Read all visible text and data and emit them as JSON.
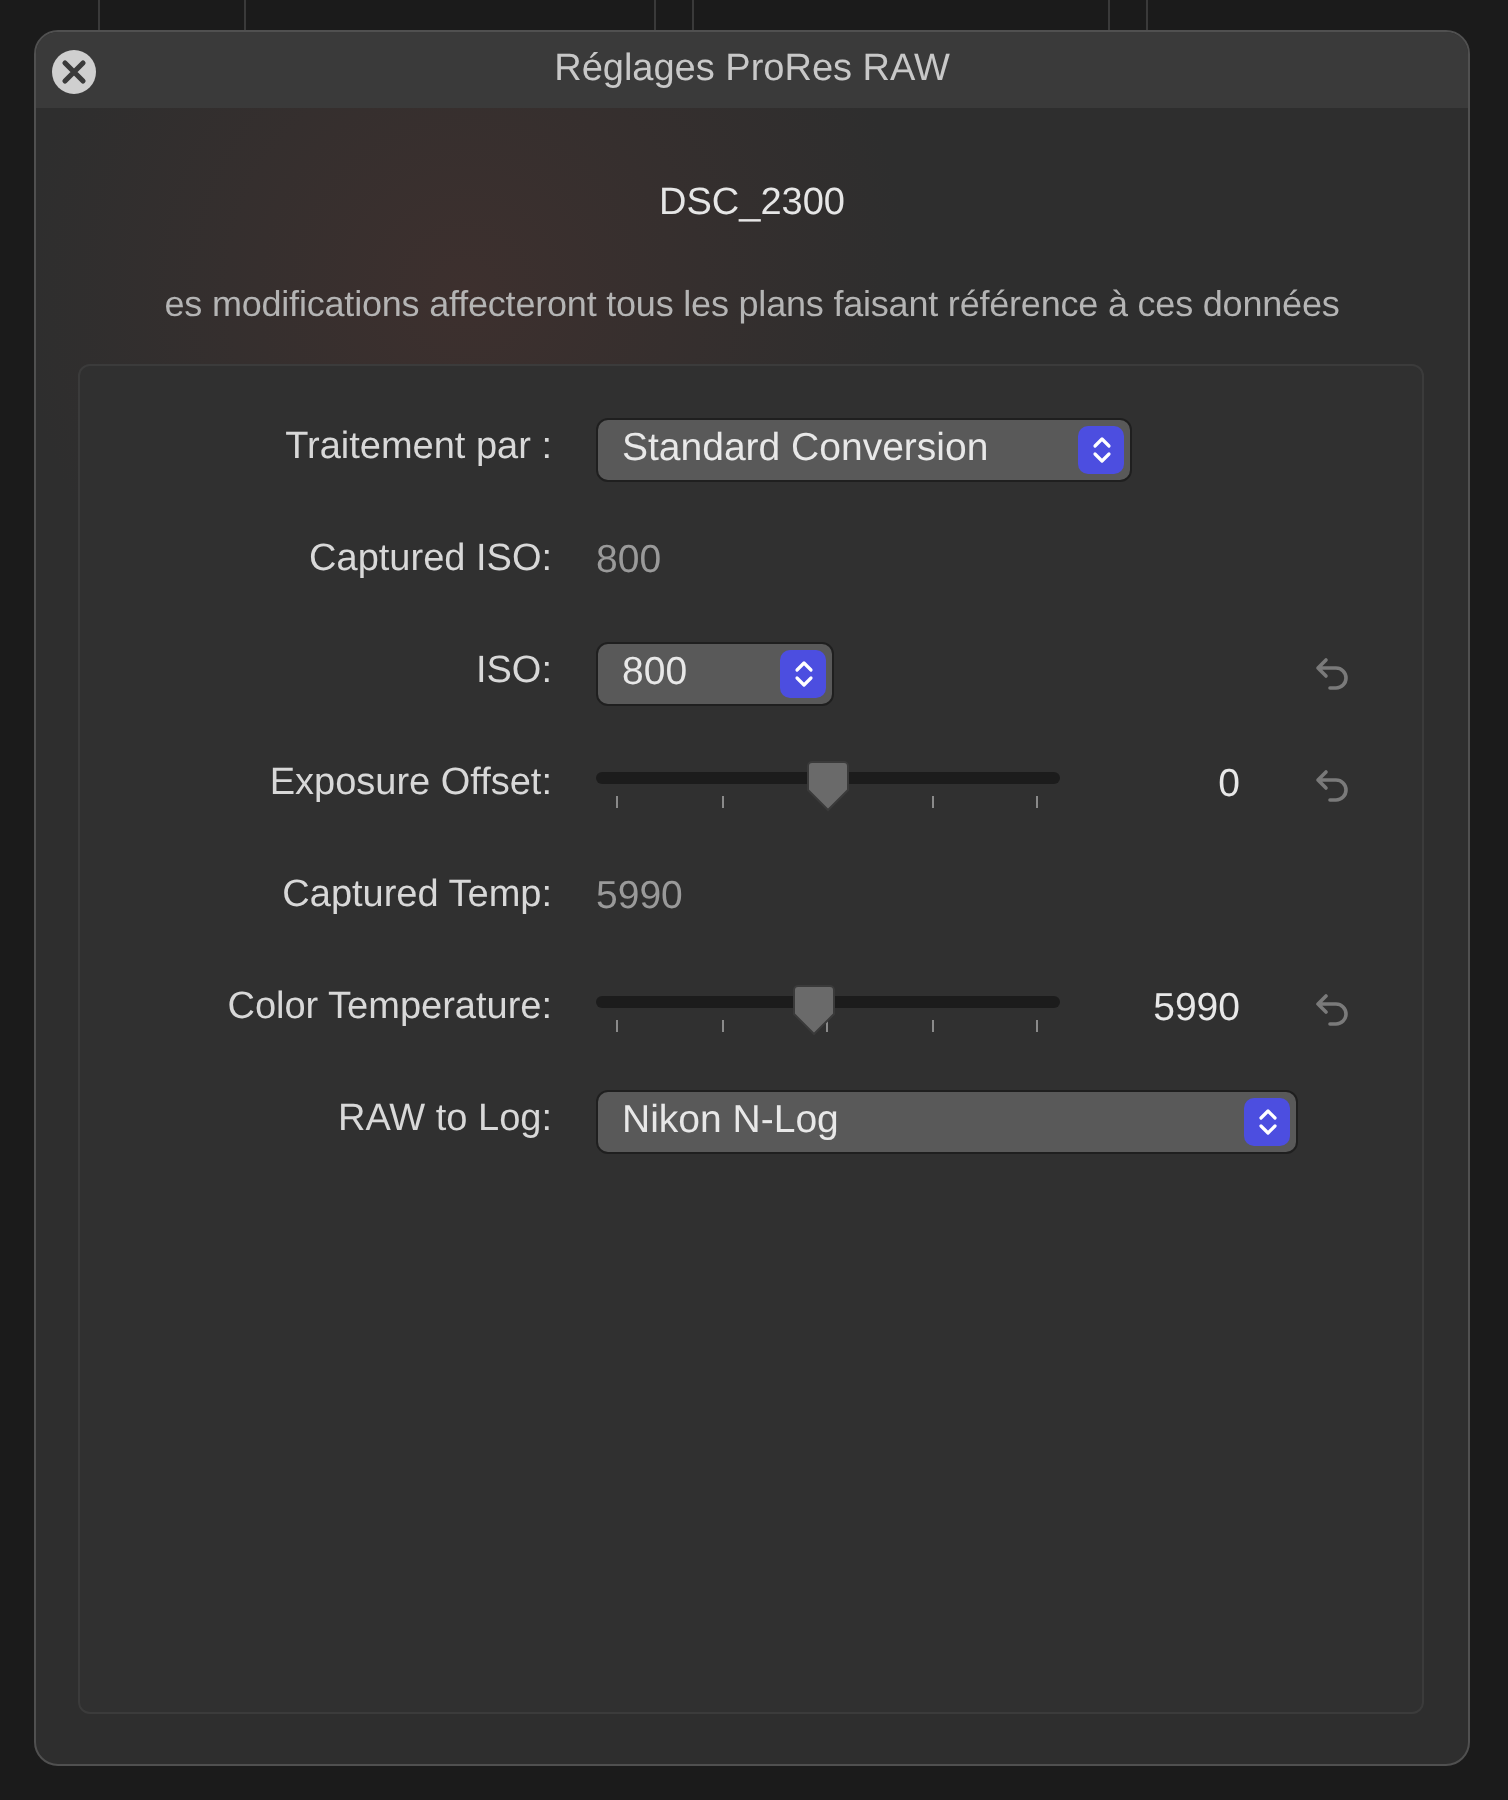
{
  "window": {
    "title": "Réglages ProRes RAW"
  },
  "clip_name": "DSC_2300",
  "notice": "es modifications affecteront tous les plans faisant référence à ces données",
  "settings": [
    {
      "kind": "select",
      "label": "Traitement par :",
      "value": "Standard Conversion",
      "wide": false
    },
    {
      "kind": "readout",
      "label": "Captured ISO:",
      "value": "800"
    },
    {
      "kind": "select",
      "label": "ISO:",
      "value": "800",
      "wide": false,
      "resettable": true
    },
    {
      "kind": "slider",
      "label": "Exposure Offset:",
      "level": 0.5,
      "value": "0",
      "resettable": true
    },
    {
      "kind": "readout",
      "label": "Captured Temp:",
      "value": "5990"
    },
    {
      "kind": "slider",
      "label": "Color Temperature:",
      "level": 0.47,
      "value": "5990",
      "resettable": true
    },
    {
      "kind": "select",
      "label": "RAW to Log:",
      "value": "Nikon N-Log",
      "wide": true
    }
  ]
}
